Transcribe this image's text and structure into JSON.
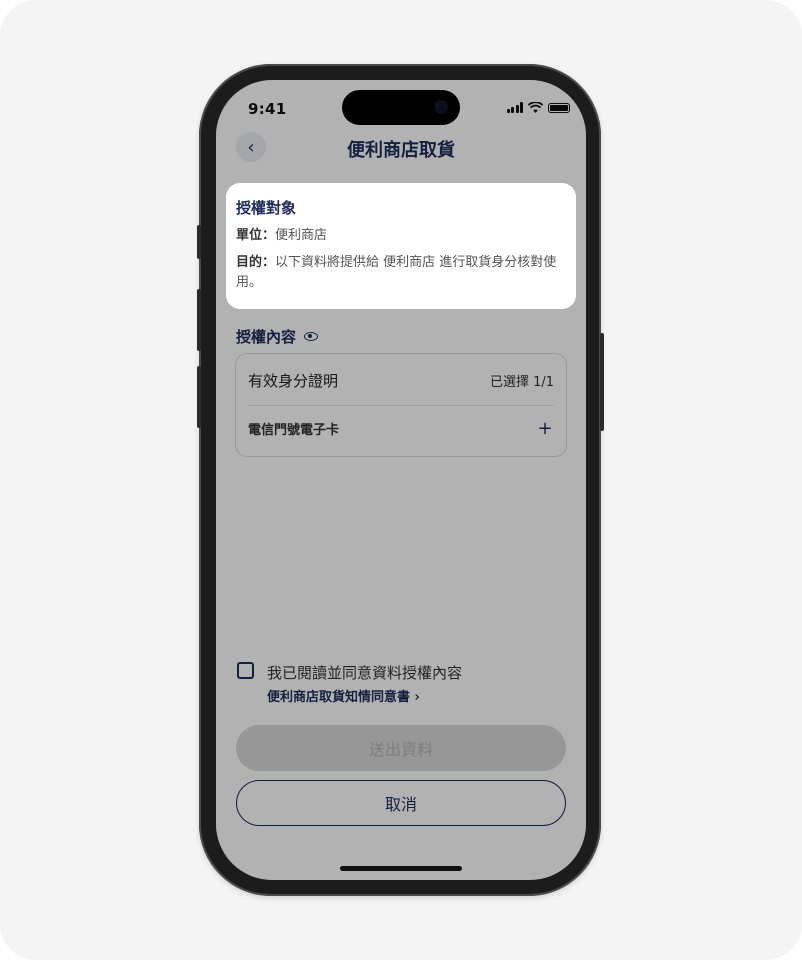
{
  "status": {
    "time": "9:41"
  },
  "header": {
    "back_icon": "chevron-left-icon",
    "title": "便利商店取貨"
  },
  "auth_target": {
    "heading": "授權對象",
    "unit_label": "單位：",
    "unit_value": "便利商店",
    "purpose_label": "目的：",
    "purpose_value": "以下資料將提供給 便利商店 進行取貨身分核對使用。"
  },
  "auth_content": {
    "heading": "授權內容",
    "eye_icon": "eye-icon",
    "item_title": "有效身分證明",
    "item_status": "已選擇 1/1",
    "sub_item": "電信門號電子卡",
    "add_icon": "plus-icon"
  },
  "agreement": {
    "text": "我已閱讀並同意資料授權內容",
    "link": "便利商店取貨知情同意書 ›"
  },
  "buttons": {
    "submit": "送出資料",
    "cancel": "取消"
  },
  "colors": {
    "primary": "#1f2d5c",
    "disabled_bg": "#d9d9d9",
    "disabled_text": "#b3b3b3"
  }
}
